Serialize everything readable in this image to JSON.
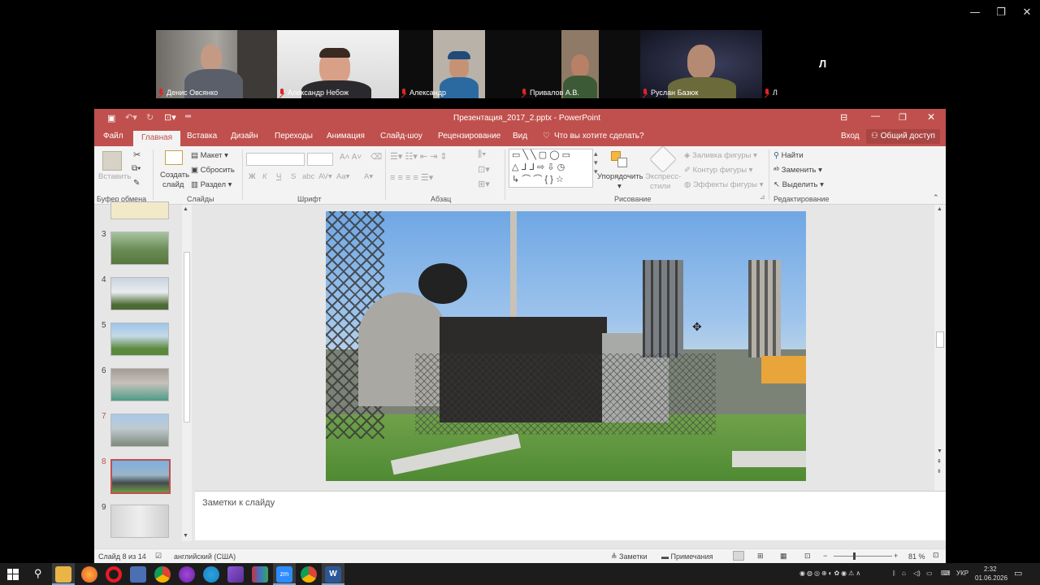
{
  "zoom": {
    "participants": [
      {
        "name": "Денис Овсянко"
      },
      {
        "name": "Александр Небож"
      },
      {
        "name": "Александр"
      },
      {
        "name": "Привалов А.В."
      },
      {
        "name": "Руслан Базюк"
      },
      {
        "name": "Л"
      }
    ],
    "avatar_letter": "Л"
  },
  "ppt": {
    "title": "Презентация_2017_2.pptx - PowerPoint",
    "tabs": [
      "Файл",
      "Главная",
      "Вставка",
      "Дизайн",
      "Переходы",
      "Анимация",
      "Слайд-шоу",
      "Рецензирование",
      "Вид"
    ],
    "tell_me": "Что вы хотите сделать?",
    "signin": "Вход",
    "share": "Общий доступ",
    "ribbon": {
      "paste": "Вставить",
      "clipboard": "Буфер обмена",
      "new_slide_1": "Создать",
      "new_slide_2": "слайд",
      "layout": "Макет",
      "reset": "Сбросить",
      "section": "Раздел",
      "slides": "Слайды",
      "font": "Шрифт",
      "bold": "Ж",
      "italic": "К",
      "underline": "Ч",
      "strike": "S",
      "paragraph": "Абзац",
      "arrange": "Упорядочить",
      "quick_styles_1": "Экспресс-",
      "quick_styles_2": "стили",
      "shape_fill": "Заливка фигуры",
      "shape_outline": "Контур фигуры",
      "shape_effects": "Эффекты фигуры",
      "drawing": "Рисование",
      "find": "Найти",
      "replace": "Заменить",
      "select": "Выделить",
      "editing": "Редактирование"
    },
    "thumbnails": [
      {
        "num": "3"
      },
      {
        "num": "4"
      },
      {
        "num": "5"
      },
      {
        "num": "6"
      },
      {
        "num": "7"
      },
      {
        "num": "8"
      },
      {
        "num": "9"
      }
    ],
    "notes_placeholder": "Заметки к слайду",
    "status": {
      "slide": "Слайд 8 из 14",
      "language": "английский (США)",
      "notes": "Заметки",
      "comments": "Примечания",
      "zoom": "81 %"
    }
  },
  "taskbar": {
    "lang": "УКР",
    "time": "2:32",
    "date": "01.06.2026"
  }
}
